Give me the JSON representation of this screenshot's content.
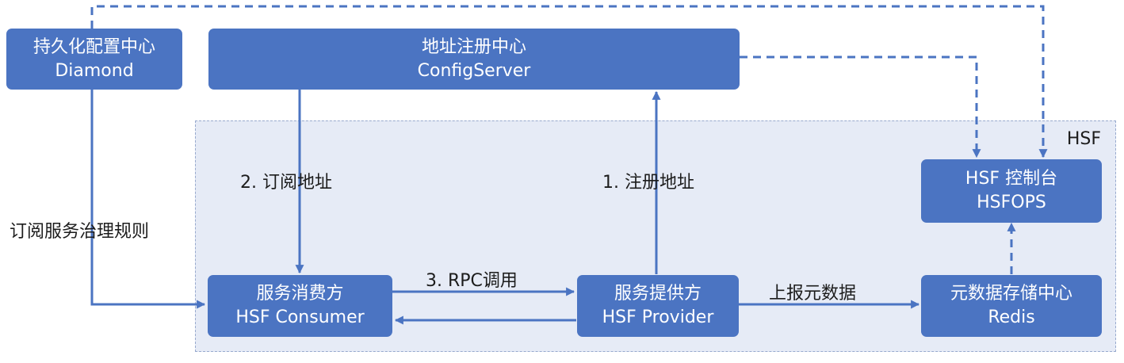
{
  "region": {
    "label": "HSF"
  },
  "nodes": {
    "diamond": {
      "line1": "持久化配置中心",
      "line2": "Diamond"
    },
    "config": {
      "line1": "地址注册中心",
      "line2": "ConfigServer"
    },
    "hsfops": {
      "line1": "HSF 控制台",
      "line2": "HSFOPS"
    },
    "consumer": {
      "line1": "服务消费方",
      "line2": "HSF Consumer"
    },
    "provider": {
      "line1": "服务提供方",
      "line2": "HSF Provider"
    },
    "redis": {
      "line1": "元数据存储中心",
      "line2": "Redis"
    }
  },
  "edges": {
    "subscribe_rules": "订阅服务治理规则",
    "subscribe_address": "2. 订阅地址",
    "register_address": "1. 注册地址",
    "rpc_call": "3. RPC调用",
    "report_metadata": "上报元数据"
  },
  "colors": {
    "node": "#4b74c2",
    "line": "#4b74c2",
    "region": "#e6ebf6"
  }
}
